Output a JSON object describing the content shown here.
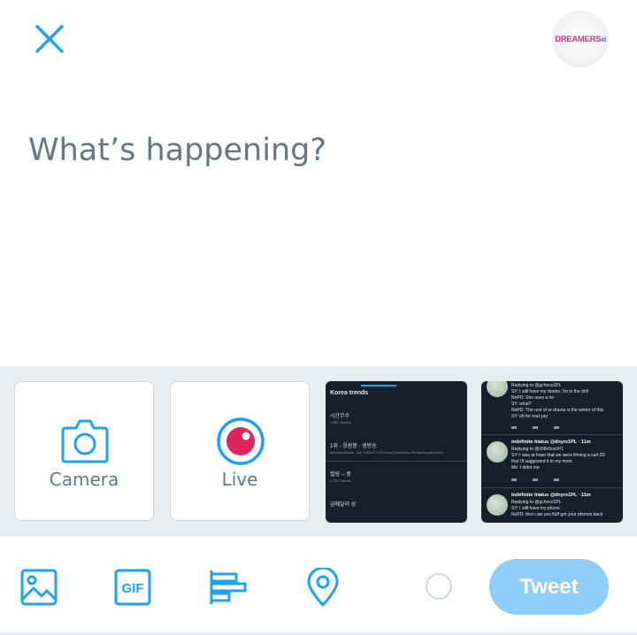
{
  "header": {
    "close_label": "close",
    "avatar_text_main": "DREAMERS",
    "avatar_text_suffix": "id"
  },
  "compose": {
    "placeholder": "What’s happening?"
  },
  "media_tray": {
    "camera_label": "Camera",
    "live_label": "Live",
    "thumbnail_1": {
      "heading": "Korea trends",
      "items": [
        {
          "title": "시간무수",
          "sub": "1,357 Tweets"
        },
        {
          "title": "1위 - 응원봉 - 생방송",
          "sub": "#DreamyWorld - 1st TODAY! STS Korea Dreamers Streaming about this"
        },
        {
          "title": "컬링 -- 중",
          "sub": "2,718 Tweets"
        },
        {
          "title": "금메달리 성",
          "sub": ""
        }
      ]
    },
    "thumbnail_2": {
      "tweets": [
        {
          "name": "",
          "lines": [
            "Replying to @gchoco1PL",
            "SY: I still have my drams. I'm in the drill",
            "NoPD: She uses a lot",
            "SY: what?",
            "NoPD: The rest of ur drama is the winter of this",
            "SY: oh for real yay"
          ]
        },
        {
          "name": "indefinite hiatus @dnyre1PL · 11m",
          "lines": [
            "Replying to @ch8n5ox1PL",
            "SY: I was at hope that we were filming a cart DF",
            "that i'll suggested it to my mom",
            "Me: I didnt me"
          ]
        },
        {
          "name": "indefinite hiatus @dnyre1PL · 11m",
          "lines": [
            "Replying to @gchoco1PL",
            "SY: I still have my phone",
            "NoPD: then can you fluff get your phones back"
          ]
        }
      ]
    }
  },
  "toolbar": {
    "icons": [
      "image-icon",
      "gif-icon",
      "poll-icon",
      "location-icon"
    ],
    "gif_text": "GIF",
    "tweet_label": "Tweet"
  },
  "colors": {
    "accent": "#1da1f2",
    "tweet_disabled": "#8ecdf8",
    "placeholder": "#657786",
    "tray_bg": "#e6ecf0",
    "live_dot": "#e0245e"
  }
}
